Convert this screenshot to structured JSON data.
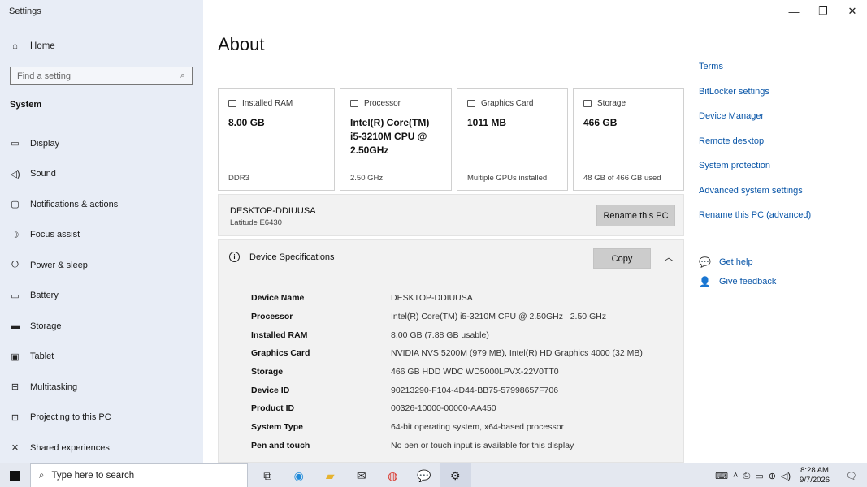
{
  "app": {
    "title": "Settings"
  },
  "window_controls": {
    "minimize": "—",
    "restore": "❐",
    "close": "✕"
  },
  "sidebar": {
    "home_label": "Home",
    "search_placeholder": "Find a setting",
    "section_title": "System",
    "items": [
      {
        "label": "Display",
        "icon": "display-icon",
        "glyph": "▭"
      },
      {
        "label": "Sound",
        "icon": "sound-icon",
        "glyph": "◁)"
      },
      {
        "label": "Notifications & actions",
        "icon": "notifications-icon",
        "glyph": "▢"
      },
      {
        "label": "Focus assist",
        "icon": "focus-assist-icon",
        "glyph": "☽"
      },
      {
        "label": "Power & sleep",
        "icon": "power-icon",
        "glyph": "⏻"
      },
      {
        "label": "Battery",
        "icon": "battery-icon",
        "glyph": "▭"
      },
      {
        "label": "Storage",
        "icon": "storage-icon",
        "glyph": "▬"
      },
      {
        "label": "Tablet",
        "icon": "tablet-icon",
        "glyph": "▣"
      },
      {
        "label": "Multitasking",
        "icon": "multitasking-icon",
        "glyph": "⊟"
      },
      {
        "label": "Projecting to this PC",
        "icon": "projecting-icon",
        "glyph": "⊡"
      },
      {
        "label": "Shared experiences",
        "icon": "shared-experiences-icon",
        "glyph": "✕"
      }
    ]
  },
  "main": {
    "title": "About",
    "cards": [
      {
        "title": "Installed RAM",
        "value": "8.00 GB",
        "foot": "DDR3",
        "icon": "ram-icon"
      },
      {
        "title": "Processor",
        "value": "Intel(R) Core(TM) i5-3210M CPU @ 2.50GHz",
        "foot": "2.50 GHz",
        "icon": "processor-icon"
      },
      {
        "title": "Graphics Card",
        "value": "1011 MB",
        "foot": "Multiple GPUs installed",
        "icon": "graphics-card-icon"
      },
      {
        "title": "Storage",
        "value": "466 GB",
        "foot": "48 GB of 466 GB used",
        "icon": "storage-card-icon"
      }
    ],
    "device": {
      "name": "DESKTOP-DDIUUSA",
      "model": "Latitude E6430",
      "rename_label": "Rename this PC"
    },
    "specs": {
      "heading": "Device Specifications",
      "copy_label": "Copy",
      "rows": [
        {
          "key": "Device Name",
          "value": "DESKTOP-DDIUUSA"
        },
        {
          "key": "Processor",
          "value": "Intel(R) Core(TM) i5-3210M CPU @ 2.50GHz   2.50 GHz"
        },
        {
          "key": "Installed RAM",
          "value": "8.00 GB (7.88 GB usable)"
        },
        {
          "key": "Graphics Card",
          "value": "NVIDIA NVS 5200M (979 MB), Intel(R) HD Graphics 4000 (32 MB)"
        },
        {
          "key": "Storage",
          "value": "466 GB HDD WDC WD5000LPVX-22V0TT0"
        },
        {
          "key": "Device ID",
          "value": "90213290-F104-4D44-BB75-57998657F706"
        },
        {
          "key": "Product ID",
          "value": "00326-10000-00000-AA450"
        },
        {
          "key": "System Type",
          "value": "64-bit operating system, x64-based processor"
        },
        {
          "key": "Pen and touch",
          "value": "No pen or touch input is available for this display"
        }
      ]
    }
  },
  "related_links": [
    "Terms",
    "BitLocker settings",
    "Device Manager",
    "Remote desktop",
    "System protection",
    "Advanced system settings",
    "Rename this PC (advanced)"
  ],
  "help": {
    "get_help": "Get help",
    "give_feedback": "Give feedback"
  },
  "taskbar": {
    "search_placeholder": "Type here to search",
    "apps": [
      {
        "name": "task-view-icon",
        "glyph": "⧉"
      },
      {
        "name": "edge-icon",
        "glyph": "◉",
        "color": "#1f8ad9"
      },
      {
        "name": "file-explorer-icon",
        "glyph": "▰",
        "color": "#e6b330"
      },
      {
        "name": "mail-icon",
        "glyph": "✉",
        "color": "#222"
      },
      {
        "name": "chrome-icon",
        "glyph": "◍",
        "color": "#d93025"
      },
      {
        "name": "chat-icon",
        "glyph": "💬",
        "color": "#222"
      },
      {
        "name": "settings-icon",
        "glyph": "⚙",
        "color": "#222",
        "active": true
      }
    ],
    "tray_icons": [
      "keyboard-icon",
      "chevron-up-icon",
      "device-icon",
      "battery-tray-icon",
      "network-icon",
      "volume-icon"
    ],
    "time": "8:28 AM",
    "date": "9/7/2026"
  }
}
